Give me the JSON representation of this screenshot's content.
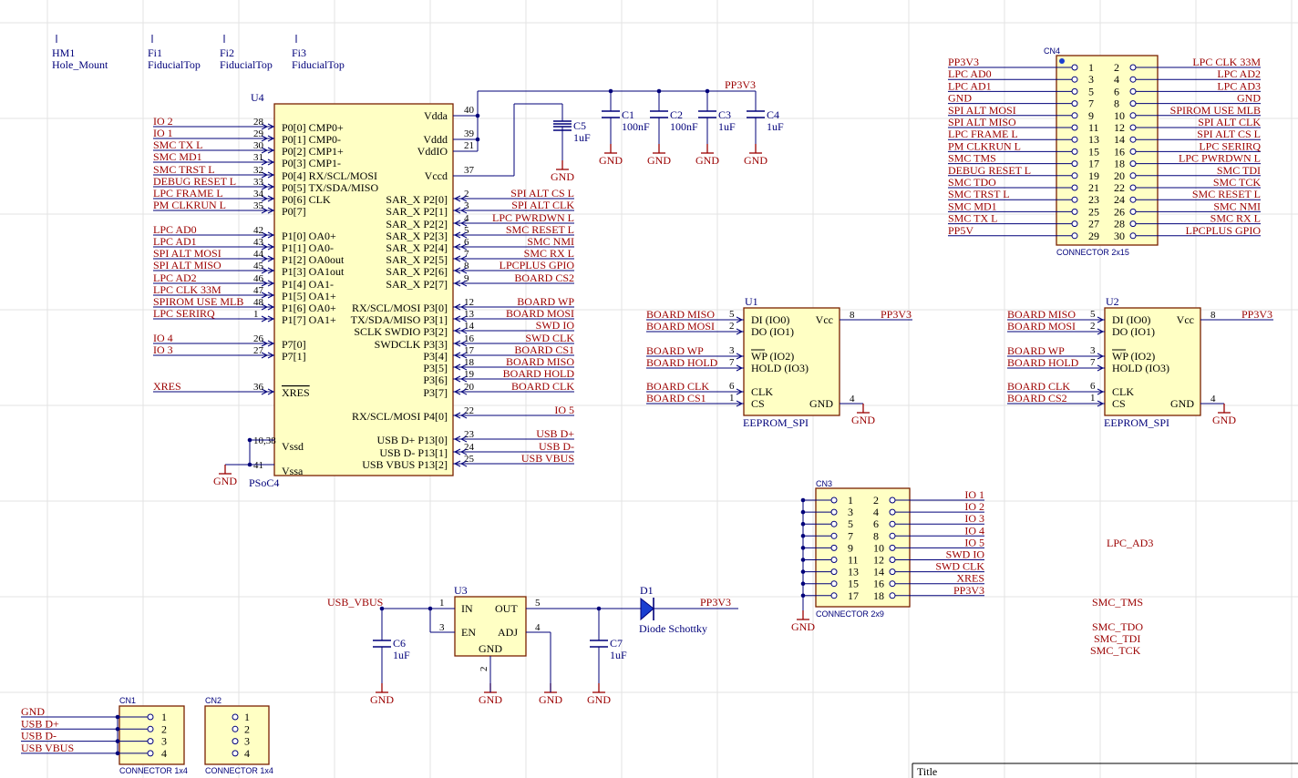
{
  "footer": {
    "title_label": "Title"
  },
  "mech": [
    {
      "ref": "HM1",
      "val": "Hole_Mount"
    },
    {
      "ref": "Fi1",
      "val": "FiducialTop"
    },
    {
      "ref": "Fi2",
      "val": "FiducialTop"
    },
    {
      "ref": "Fi3",
      "val": "FiducialTop"
    }
  ],
  "u4": {
    "ref": "U4",
    "part": "PSoC4",
    "left_pins": [
      {
        "num": "28",
        "name": "P0[0] CMP0+",
        "net": "IO_2"
      },
      {
        "num": "29",
        "name": "P0[1] CMP0-",
        "net": "IO_1"
      },
      {
        "num": "30",
        "name": "P0[2] CMP1+",
        "net": "SMC_TX_L"
      },
      {
        "num": "31",
        "name": "P0[3] CMP1-",
        "net": "SMC_MD1"
      },
      {
        "num": "32",
        "name": "P0[4] RX/SCL/MOSI",
        "net": "SMC_TRST_L"
      },
      {
        "num": "33",
        "name": "P0[5] TX/SDA/MISO",
        "net": "DEBUG_RESET_L"
      },
      {
        "num": "34",
        "name": "P0[6] CLK",
        "net": "LPC_FRAME_L"
      },
      {
        "num": "35",
        "name": "P0[7]",
        "net": "PM_CLKRUN_L"
      },
      {
        "num": "42",
        "name": "P1[0] OA0+",
        "net": "LPC_AD0"
      },
      {
        "num": "43",
        "name": "P1[1] OA0-",
        "net": "LPC_AD1"
      },
      {
        "num": "44",
        "name": "P1[2] OA0out",
        "net": "SPI_ALT_MOSI"
      },
      {
        "num": "45",
        "name": "P1[3] OA1out",
        "net": "SPI_ALT_MISO"
      },
      {
        "num": "46",
        "name": "P1[4] OA1-",
        "net": "LPC_AD2"
      },
      {
        "num": "47",
        "name": "P1[5] OA1+",
        "net": "LPC_CLK_33M"
      },
      {
        "num": "48",
        "name": "P1[6] OA0+",
        "net": "SPIROM_USE_MLB"
      },
      {
        "num": "1",
        "name": "P1[7] OA1+",
        "net": "LPC_SERIRQ"
      },
      {
        "num": "26",
        "name": "P7[0]",
        "net": "IO_4"
      },
      {
        "num": "27",
        "name": "P7[1]",
        "net": "IO_3"
      },
      {
        "num": "36",
        "name": "XRES",
        "net": "XRES"
      },
      {
        "num": "10,38",
        "name": "Vssd",
        "net": ""
      },
      {
        "num": "41",
        "name": "Vssa",
        "net": ""
      }
    ],
    "right_pins": [
      {
        "num": "40",
        "name": "Vdda",
        "net": ""
      },
      {
        "num": "39",
        "name": "Vddd",
        "net": ""
      },
      {
        "num": "21",
        "name": "VddIO",
        "net": ""
      },
      {
        "num": "37",
        "name": "Vccd",
        "net": ""
      },
      {
        "num": "2",
        "name": "SAR_X P2[0]",
        "net": "SPI_ALT_CS_L"
      },
      {
        "num": "3",
        "name": "SAR_X P2[1]",
        "net": "SPI_ALT_CLK"
      },
      {
        "num": "4",
        "name": "SAR_X P2[2]",
        "net": "LPC_PWRDWN_L"
      },
      {
        "num": "5",
        "name": "SAR_X P2[3]",
        "net": "SMC_RESET_L"
      },
      {
        "num": "6",
        "name": "SAR_X P2[4]",
        "net": "SMC_NMI"
      },
      {
        "num": "7",
        "name": "SAR_X P2[5]",
        "net": "SMC_RX_L"
      },
      {
        "num": "8",
        "name": "SAR_X P2[6]",
        "net": "LPCPLUS_GPIO"
      },
      {
        "num": "9",
        "name": "SAR_X P2[7]",
        "net": "BOARD_CS2"
      },
      {
        "num": "12",
        "name": "RX/SCL/MOSI P3[0]",
        "net": "BOARD_WP"
      },
      {
        "num": "13",
        "name": "TX/SDA/MISO P3[1]",
        "net": "BOARD_MOSI"
      },
      {
        "num": "14",
        "name": "SCLK SWDIO P3[2]",
        "net": "SWD_IO"
      },
      {
        "num": "16",
        "name": "SWDCLK P3[3]",
        "net": "SWD_CLK"
      },
      {
        "num": "17",
        "name": "P3[4]",
        "net": "BOARD_CS1"
      },
      {
        "num": "18",
        "name": "P3[5]",
        "net": "BOARD_MISO"
      },
      {
        "num": "19",
        "name": "P3[6]",
        "net": "BOARD_HOLD"
      },
      {
        "num": "20",
        "name": "P3[7]",
        "net": "BOARD_CLK"
      },
      {
        "num": "22",
        "name": "RX/SCL/MOSI P4[0]",
        "net": "IO_5"
      },
      {
        "num": "23",
        "name": "USB D+ P13[0]",
        "net": "USB_D+"
      },
      {
        "num": "24",
        "name": "USB D- P13[1]",
        "net": "USB_D-"
      },
      {
        "num": "25",
        "name": "USB VBUS P13[2]",
        "net": "USB_VBUS"
      }
    ]
  },
  "caps": [
    {
      "ref": "C5",
      "val": "1uF"
    },
    {
      "ref": "C1",
      "val": "100nF"
    },
    {
      "ref": "C2",
      "val": "100nF"
    },
    {
      "ref": "C3",
      "val": "1uF"
    },
    {
      "ref": "C4",
      "val": "1uF"
    },
    {
      "ref": "C6",
      "val": "1uF"
    },
    {
      "ref": "C7",
      "val": "1uF"
    }
  ],
  "power": {
    "pp3v3": "PP3V3",
    "gnd": "GND",
    "usb_vbus": "USB_VBUS"
  },
  "eeprom": [
    {
      "ref": "U1",
      "part": "EEPROM_SPI",
      "pins": [
        {
          "num": "5",
          "name": "DI (IO0)",
          "net": "BOARD_MISO"
        },
        {
          "num": "2",
          "name": "DO (IO1)",
          "net": "BOARD_MOSI"
        },
        {
          "num": "3",
          "name": "WP (IO2)",
          "net": "BOARD_WP"
        },
        {
          "num": "7",
          "name": "HOLD (IO3)",
          "net": "BOARD_HOLD"
        },
        {
          "num": "6",
          "name": "CLK",
          "net": "BOARD_CLK"
        },
        {
          "num": "1",
          "name": "CS",
          "net": "BOARD_CS1"
        }
      ],
      "vcc": {
        "num": "8",
        "name": "Vcc",
        "net": "PP3V3"
      },
      "gnd": {
        "num": "4",
        "name": "GND",
        "net": "GND"
      }
    },
    {
      "ref": "U2",
      "part": "EEPROM_SPI",
      "pins": [
        {
          "num": "5",
          "name": "DI (IO0)",
          "net": "BOARD_MISO"
        },
        {
          "num": "2",
          "name": "DO (IO1)",
          "net": "BOARD_MOSI"
        },
        {
          "num": "3",
          "name": "WP (IO2)",
          "net": "BOARD_WP"
        },
        {
          "num": "7",
          "name": "HOLD (IO3)",
          "net": "BOARD_HOLD"
        },
        {
          "num": "6",
          "name": "CLK",
          "net": "BOARD_CLK"
        },
        {
          "num": "1",
          "name": "CS",
          "net": "BOARD_CS2"
        }
      ],
      "vcc": {
        "num": "8",
        "name": "Vcc",
        "net": "PP3V3"
      },
      "gnd": {
        "num": "4",
        "name": "GND",
        "net": "GND"
      }
    }
  ],
  "cn4": {
    "ref": "CN4",
    "type": "CONNECTOR 2x15",
    "left": [
      {
        "num": "1",
        "net": "PP3V3"
      },
      {
        "num": "3",
        "net": "LPC_AD0"
      },
      {
        "num": "5",
        "net": "LPC_AD1"
      },
      {
        "num": "7",
        "net": "GND"
      },
      {
        "num": "9",
        "net": "SPI_ALT_MOSI"
      },
      {
        "num": "11",
        "net": "SPI_ALT_MISO"
      },
      {
        "num": "13",
        "net": "LPC_FRAME_L"
      },
      {
        "num": "15",
        "net": "PM_CLKRUN_L"
      },
      {
        "num": "17",
        "net": "SMC_TMS"
      },
      {
        "num": "19",
        "net": "DEBUG_RESET_L"
      },
      {
        "num": "21",
        "net": "SMC_TDO"
      },
      {
        "num": "23",
        "net": "SMC_TRST_L"
      },
      {
        "num": "25",
        "net": "SMC_MD1"
      },
      {
        "num": "27",
        "net": "SMC_TX_L"
      },
      {
        "num": "29",
        "net": "PP5V"
      }
    ],
    "right": [
      {
        "num": "2",
        "net": "LPC_CLK_33M"
      },
      {
        "num": "4",
        "net": "LPC_AD2"
      },
      {
        "num": "6",
        "net": "LPC_AD3"
      },
      {
        "num": "8",
        "net": "GND"
      },
      {
        "num": "10",
        "net": "SPIROM_USE_MLB"
      },
      {
        "num": "12",
        "net": "SPI_ALT_CLK"
      },
      {
        "num": "14",
        "net": "SPI_ALT_CS_L"
      },
      {
        "num": "16",
        "net": "LPC_SERIRQ"
      },
      {
        "num": "18",
        "net": "LPC_PWRDWN_L"
      },
      {
        "num": "20",
        "net": "SMC_TDI"
      },
      {
        "num": "22",
        "net": "SMC_TCK"
      },
      {
        "num": "24",
        "net": "SMC_RESET_L"
      },
      {
        "num": "26",
        "net": "SMC_NMI"
      },
      {
        "num": "28",
        "net": "SMC_RX_L"
      },
      {
        "num": "30",
        "net": "LPCPLUS_GPIO"
      }
    ]
  },
  "cn3": {
    "ref": "CN3",
    "type": "CONNECTOR 2x9",
    "left": [
      "1",
      "3",
      "5",
      "7",
      "9",
      "11",
      "13",
      "15",
      "17"
    ],
    "right": [
      {
        "num": "2",
        "net": "IO_1"
      },
      {
        "num": "4",
        "net": "IO_2"
      },
      {
        "num": "6",
        "net": "IO_3"
      },
      {
        "num": "8",
        "net": "IO_4"
      },
      {
        "num": "10",
        "net": "IO_5"
      },
      {
        "num": "12",
        "net": "SWD_IO"
      },
      {
        "num": "14",
        "net": "SWD_CLK"
      },
      {
        "num": "16",
        "net": "XRES"
      },
      {
        "num": "18",
        "net": "PP3V3"
      }
    ]
  },
  "u3": {
    "ref": "U3",
    "pins": {
      "in": "IN",
      "out": "OUT",
      "en": "EN",
      "adj": "ADJ",
      "gnd": "GND"
    },
    "nums": {
      "in": "1",
      "out": "5",
      "en": "3",
      "adj": "4",
      "gnd": "2"
    }
  },
  "d1": {
    "ref": "D1",
    "val": "Diode Schottky"
  },
  "cn1": {
    "ref": "CN1",
    "type": "CONNECTOR 1x4",
    "nets": [
      "GND",
      "USB_D+",
      "USB_D-",
      "USB_VBUS"
    ],
    "nums": [
      "1",
      "2",
      "3",
      "4"
    ]
  },
  "cn2": {
    "ref": "CN2",
    "type": "CONNECTOR 1x4",
    "nums": [
      "1",
      "2",
      "3",
      "4"
    ]
  },
  "floating_nets": [
    "LPC_AD3",
    "SMC_TMS",
    "SMC_TDO",
    "SMC_TDI",
    "SMC_TCK"
  ]
}
